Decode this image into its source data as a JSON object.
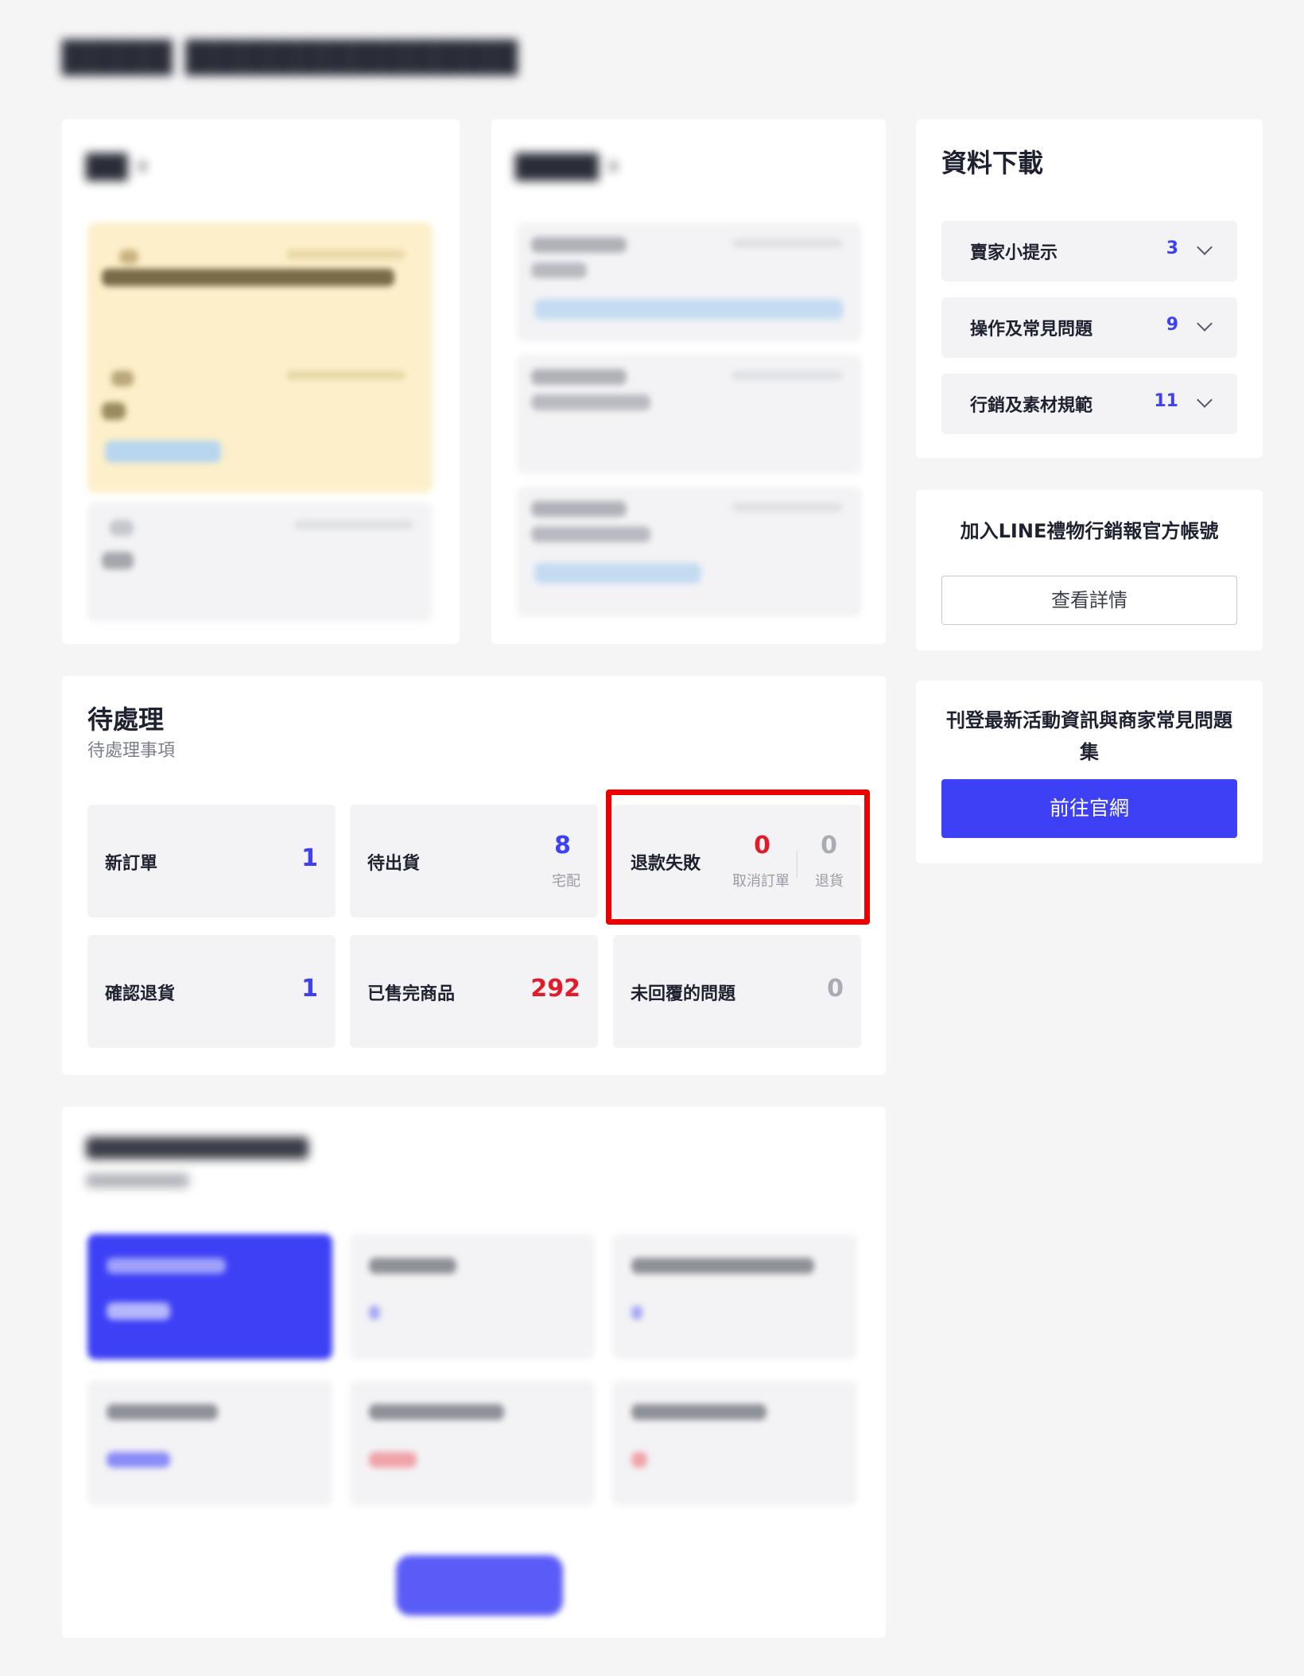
{
  "download": {
    "title": "資料下載",
    "items": [
      {
        "label": "賣家小提示",
        "count": "3"
      },
      {
        "label": "操作及常見問題",
        "count": "9"
      },
      {
        "label": "行銷及素材規範",
        "count": "11"
      }
    ]
  },
  "line_card": {
    "title": "加入LINE禮物行銷報官方帳號",
    "button": "查看詳情"
  },
  "site_card": {
    "title": "刊登最新活動資訊與商家常見問題集",
    "button": "前往官網"
  },
  "pending": {
    "title": "待處理",
    "subtitle": "待處理事項",
    "tiles": {
      "new_orders": {
        "label": "新訂單",
        "value": "1"
      },
      "to_ship": {
        "label": "待出貨",
        "value": "8",
        "sub": "宅配"
      },
      "refund_failed": {
        "label": "退款失敗",
        "cancel_value": "0",
        "cancel_sub": "取消訂單",
        "return_value": "0",
        "return_sub": "退貨"
      },
      "confirm_return": {
        "label": "確認退貨",
        "value": "1"
      },
      "sold_out": {
        "label": "已售完商品",
        "value": "292"
      },
      "unanswered": {
        "label": "未回覆的問題",
        "value": "0"
      }
    }
  },
  "colors": {
    "accent": "#3d40f5",
    "alert": "#e11b2a",
    "highlight": "#ee0000",
    "muted": "#a9acb4"
  }
}
